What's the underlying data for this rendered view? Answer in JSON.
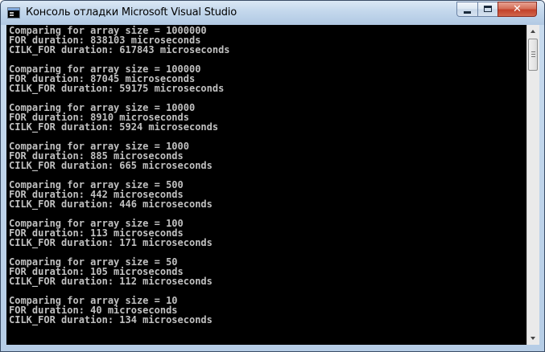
{
  "window": {
    "title": "Консоль отладки Microsoft Visual Studio",
    "close_glyph": "✕",
    "icons": {
      "app": "console-app-icon",
      "minimize": "minimize-icon",
      "maximize": "maximize-icon",
      "close": "close-icon"
    }
  },
  "console": {
    "background": "#000000",
    "text_color": "#c0c0c0",
    "output": "Comparing for array size = 1000000\nFOR duration: 838103 microseconds\nCILK_FOR duration: 617843 microseconds\n\nComparing for array size = 100000\nFOR duration: 87045 microseconds\nCILK_FOR duration: 59175 microseconds\n\nComparing for array size = 10000\nFOR duration: 8910 microseconds\nCILK_FOR duration: 5924 microseconds\n\nComparing for array size = 1000\nFOR duration: 885 microseconds\nCILK_FOR duration: 665 microseconds\n\nComparing for array size = 500\nFOR duration: 442 microseconds\nCILK_FOR duration: 446 microseconds\n\nComparing for array size = 100\nFOR duration: 113 microseconds\nCILK_FOR duration: 171 microseconds\n\nComparing for array size = 50\nFOR duration: 105 microseconds\nCILK_FOR duration: 112 microseconds\n\nComparing for array size = 10\nFOR duration: 40 microseconds\nCILK_FOR duration: 134 microseconds"
  },
  "scrollbar": {
    "icons": {
      "up": "scroll-up-arrow-icon",
      "down": "scroll-down-arrow-icon"
    },
    "position": 0
  }
}
